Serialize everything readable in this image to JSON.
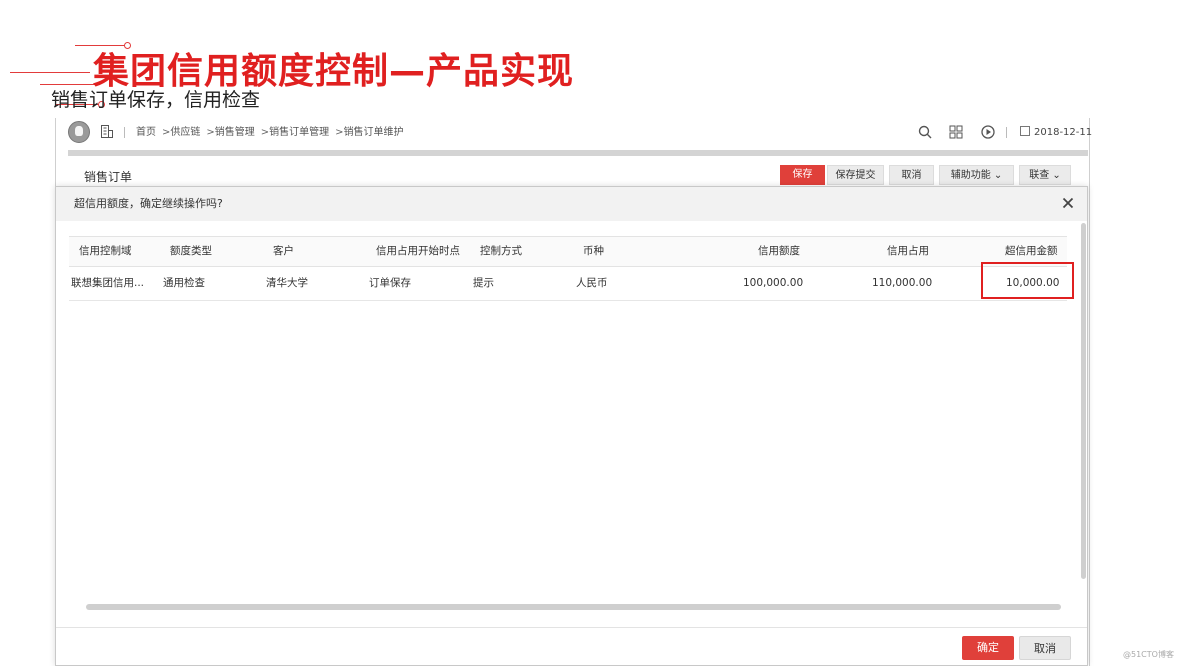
{
  "slide": {
    "title": "集团信用额度控制—产品实现",
    "subtitle": "销售订单保存，信用检查",
    "accent_color": "#e02020"
  },
  "topbar": {
    "breadcrumbs": [
      "首页",
      "供应链",
      "销售管理",
      "销售订单管理",
      "销售订单维护"
    ],
    "date": "2018-12-11",
    "icons": [
      "user-avatar",
      "org-icon",
      "search-icon",
      "grid-icon",
      "play-icon",
      "calendar-icon"
    ]
  },
  "page": {
    "title": "销售订单",
    "buttons": {
      "save": "保存",
      "save_submit": "保存提交",
      "cancel": "取消",
      "assist": "辅助功能",
      "link": "联查"
    }
  },
  "dialog": {
    "title": "超信用额度，确定继续操作吗?",
    "columns": [
      "信用控制域",
      "额度类型",
      "客户",
      "信用占用开始时点",
      "控制方式",
      "币种",
      "信用额度",
      "信用占用",
      "超信用金额"
    ],
    "rows": [
      [
        "联想集团信用...",
        "通用检查",
        "清华大学",
        "订单保存",
        "提示",
        "人民币",
        "100,000.00",
        "110,000.00",
        "10,000.00"
      ]
    ],
    "ok_label": "确定",
    "cancel_label": "取消"
  },
  "watermark": "@51CTO博客"
}
